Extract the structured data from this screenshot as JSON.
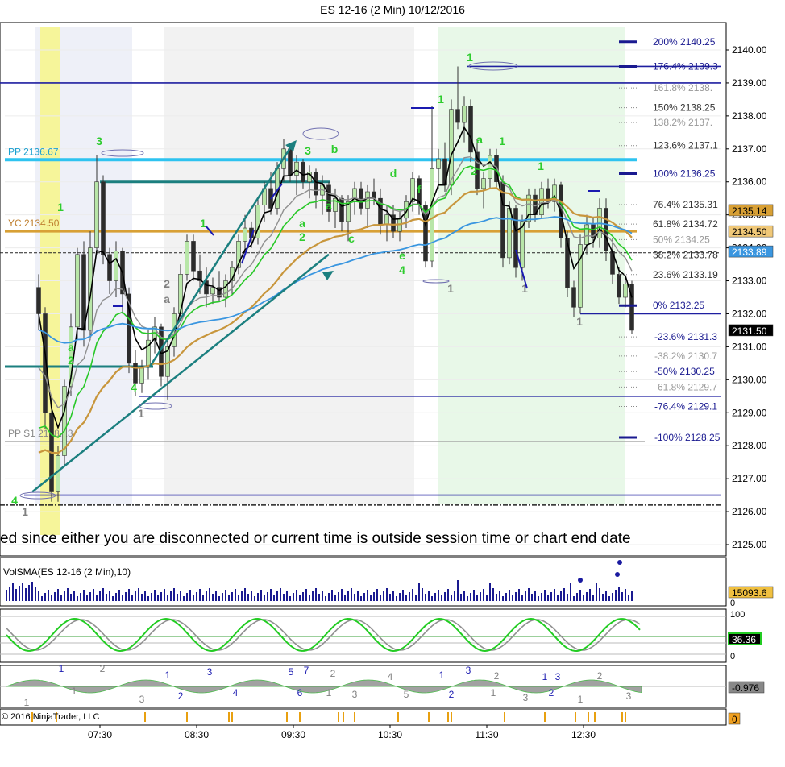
{
  "title": "ES 12-16 (2 Min)  10/12/2016",
  "copyright": "© 2016 NinjaTrader, LLC",
  "banner": "ed since either you are disconnected or current time is outside session time or chart end date",
  "colors": {
    "candle_up": "#b8e6a8",
    "candle_down": "#2c2c2c",
    "fib": "#1f1fa0",
    "pp": "#2ec3f0",
    "yc": "#d8a035",
    "ema_fast": "#000000",
    "ema_green": "#28c828",
    "ema_gold": "#c8963c",
    "ema_blue": "#3a96e0",
    "ema_gray": "#909090",
    "label_green": "#2ecc2e",
    "label_blue": "#1a1ab0",
    "label_gray": "#808080",
    "teal": "#1b7f7f"
  },
  "chart_data": [
    {
      "type": "candlestick",
      "name": "ES 12-16 (2 Min)",
      "ylim": [
        2124.8,
        2140.8
      ],
      "xlim": [
        "06:50",
        "13:50"
      ],
      "yticks": [
        "2125.00",
        "2126.00",
        "2127.00",
        "2128.00",
        "2129.00",
        "2130.00",
        "2131.00",
        "2132.00",
        "2133.00",
        "2134.00",
        "2135.00",
        "2136.00",
        "2137.00",
        "2138.00",
        "2139.00",
        "2140.00"
      ],
      "xticks": [
        "07:30",
        "08:30",
        "09:30",
        "10:30",
        "11:30",
        "12:30"
      ],
      "session_shading": [
        {
          "from": "06:50",
          "to": "07:50",
          "color": "#eef0f8"
        },
        {
          "from": "08:10",
          "to": "10:45",
          "color": "#f2f2f2"
        },
        {
          "from": "11:00",
          "to": "12:56",
          "color": "#e8f8e8"
        },
        {
          "from": "06:53",
          "to": "07:05",
          "color": "#f6f59a"
        }
      ],
      "candles": [
        {
          "t": "06:52",
          "o": 2132.8,
          "h": 2133.2,
          "l": 2131.5,
          "c": 2132.0
        },
        {
          "t": "06:56",
          "o": 2132.0,
          "h": 2132.2,
          "l": 2128.5,
          "c": 2129.0
        },
        {
          "t": "07:00",
          "o": 2129.0,
          "h": 2129.5,
          "l": 2126.3,
          "c": 2126.6
        },
        {
          "t": "07:04",
          "o": 2126.6,
          "h": 2128.0,
          "l": 2126.3,
          "c": 2127.7
        },
        {
          "t": "07:08",
          "o": 2127.7,
          "h": 2130.0,
          "l": 2127.4,
          "c": 2129.8
        },
        {
          "t": "07:12",
          "o": 2129.8,
          "h": 2132.0,
          "l": 2129.5,
          "c": 2131.6
        },
        {
          "t": "07:16",
          "o": 2131.6,
          "h": 2134.0,
          "l": 2131.2,
          "c": 2133.8
        },
        {
          "t": "07:20",
          "o": 2133.8,
          "h": 2134.2,
          "l": 2131.0,
          "c": 2131.5
        },
        {
          "t": "07:24",
          "o": 2131.5,
          "h": 2134.5,
          "l": 2131.2,
          "c": 2134.0
        },
        {
          "t": "07:28",
          "o": 2134.0,
          "h": 2136.8,
          "l": 2133.8,
          "c": 2136.0
        },
        {
          "t": "07:32",
          "o": 2136.0,
          "h": 2136.2,
          "l": 2133.5,
          "c": 2133.8
        },
        {
          "t": "07:36",
          "o": 2133.8,
          "h": 2134.0,
          "l": 2132.6,
          "c": 2133.0
        },
        {
          "t": "07:40",
          "o": 2133.0,
          "h": 2134.2,
          "l": 2132.5,
          "c": 2133.9
        },
        {
          "t": "07:44",
          "o": 2133.9,
          "h": 2134.0,
          "l": 2132.0,
          "c": 2132.6
        },
        {
          "t": "07:48",
          "o": 2132.6,
          "h": 2132.8,
          "l": 2130.2,
          "c": 2130.5
        },
        {
          "t": "07:52",
          "o": 2130.5,
          "h": 2130.9,
          "l": 2129.5,
          "c": 2129.9
        },
        {
          "t": "07:56",
          "o": 2129.9,
          "h": 2130.6,
          "l": 2129.6,
          "c": 2130.4
        },
        {
          "t": "08:00",
          "o": 2130.4,
          "h": 2131.5,
          "l": 2130.0,
          "c": 2131.2
        },
        {
          "t": "08:04",
          "o": 2131.2,
          "h": 2131.9,
          "l": 2130.8,
          "c": 2131.6
        },
        {
          "t": "08:08",
          "o": 2131.6,
          "h": 2131.7,
          "l": 2129.8,
          "c": 2130.1
        },
        {
          "t": "08:12",
          "o": 2130.1,
          "h": 2131.2,
          "l": 2129.4,
          "c": 2131.0
        },
        {
          "t": "08:16",
          "o": 2131.0,
          "h": 2132.2,
          "l": 2130.7,
          "c": 2132.0
        },
        {
          "t": "08:20",
          "o": 2132.0,
          "h": 2133.5,
          "l": 2131.8,
          "c": 2133.2
        },
        {
          "t": "08:24",
          "o": 2133.2,
          "h": 2134.4,
          "l": 2133.0,
          "c": 2134.2
        },
        {
          "t": "08:28",
          "o": 2134.2,
          "h": 2134.4,
          "l": 2133.0,
          "c": 2133.3
        },
        {
          "t": "08:32",
          "o": 2133.3,
          "h": 2133.8,
          "l": 2132.6,
          "c": 2133.0
        },
        {
          "t": "08:36",
          "o": 2133.0,
          "h": 2133.4,
          "l": 2132.2,
          "c": 2132.6
        },
        {
          "t": "08:40",
          "o": 2132.6,
          "h": 2133.1,
          "l": 2132.3,
          "c": 2132.8
        },
        {
          "t": "08:44",
          "o": 2132.8,
          "h": 2133.3,
          "l": 2132.4,
          "c": 2132.5
        },
        {
          "t": "08:48",
          "o": 2132.5,
          "h": 2133.2,
          "l": 2132.2,
          "c": 2133.0
        },
        {
          "t": "08:52",
          "o": 2133.0,
          "h": 2133.6,
          "l": 2132.6,
          "c": 2133.4
        },
        {
          "t": "08:56",
          "o": 2133.4,
          "h": 2134.4,
          "l": 2133.2,
          "c": 2134.2
        },
        {
          "t": "09:00",
          "o": 2134.2,
          "h": 2135.0,
          "l": 2133.8,
          "c": 2134.6
        },
        {
          "t": "09:04",
          "o": 2134.6,
          "h": 2134.8,
          "l": 2134.0,
          "c": 2134.3
        },
        {
          "t": "09:08",
          "o": 2134.3,
          "h": 2135.5,
          "l": 2134.1,
          "c": 2135.3
        },
        {
          "t": "09:12",
          "o": 2135.3,
          "h": 2136.0,
          "l": 2134.8,
          "c": 2135.8
        },
        {
          "t": "09:16",
          "o": 2135.8,
          "h": 2136.3,
          "l": 2135.0,
          "c": 2135.2
        },
        {
          "t": "09:20",
          "o": 2135.2,
          "h": 2136.6,
          "l": 2135.0,
          "c": 2136.4
        },
        {
          "t": "09:24",
          "o": 2136.4,
          "h": 2137.3,
          "l": 2136.0,
          "c": 2137.0
        },
        {
          "t": "09:28",
          "o": 2137.0,
          "h": 2137.1,
          "l": 2136.0,
          "c": 2136.2
        },
        {
          "t": "09:32",
          "o": 2136.2,
          "h": 2136.8,
          "l": 2135.6,
          "c": 2136.6
        },
        {
          "t": "09:36",
          "o": 2136.6,
          "h": 2136.7,
          "l": 2135.8,
          "c": 2136.0
        },
        {
          "t": "09:40",
          "o": 2136.0,
          "h": 2136.5,
          "l": 2135.5,
          "c": 2136.3
        },
        {
          "t": "09:44",
          "o": 2136.3,
          "h": 2136.4,
          "l": 2135.2,
          "c": 2135.6
        },
        {
          "t": "09:48",
          "o": 2135.6,
          "h": 2136.2,
          "l": 2135.0,
          "c": 2135.9
        },
        {
          "t": "09:52",
          "o": 2135.9,
          "h": 2136.0,
          "l": 2134.8,
          "c": 2135.1
        },
        {
          "t": "09:56",
          "o": 2135.1,
          "h": 2135.8,
          "l": 2134.6,
          "c": 2135.5
        },
        {
          "t": "10:00",
          "o": 2135.5,
          "h": 2135.6,
          "l": 2134.5,
          "c": 2134.8
        },
        {
          "t": "10:04",
          "o": 2134.8,
          "h": 2135.6,
          "l": 2134.2,
          "c": 2135.4
        },
        {
          "t": "10:08",
          "o": 2135.4,
          "h": 2136.0,
          "l": 2135.0,
          "c": 2135.8
        },
        {
          "t": "10:12",
          "o": 2135.8,
          "h": 2136.0,
          "l": 2135.0,
          "c": 2135.2
        },
        {
          "t": "10:16",
          "o": 2135.2,
          "h": 2135.9,
          "l": 2134.6,
          "c": 2135.7
        },
        {
          "t": "10:20",
          "o": 2135.7,
          "h": 2136.1,
          "l": 2135.3,
          "c": 2135.5
        },
        {
          "t": "10:24",
          "o": 2135.5,
          "h": 2135.8,
          "l": 2134.4,
          "c": 2134.7
        },
        {
          "t": "10:28",
          "o": 2134.7,
          "h": 2135.3,
          "l": 2134.2,
          "c": 2135.0
        },
        {
          "t": "10:32",
          "o": 2135.0,
          "h": 2135.3,
          "l": 2134.3,
          "c": 2134.5
        },
        {
          "t": "10:36",
          "o": 2134.5,
          "h": 2135.1,
          "l": 2134.2,
          "c": 2134.9
        },
        {
          "t": "10:40",
          "o": 2134.9,
          "h": 2135.6,
          "l": 2134.6,
          "c": 2135.4
        },
        {
          "t": "10:44",
          "o": 2135.4,
          "h": 2136.3,
          "l": 2135.1,
          "c": 2136.1
        },
        {
          "t": "10:48",
          "o": 2136.1,
          "h": 2136.2,
          "l": 2135.0,
          "c": 2135.3
        },
        {
          "t": "10:52",
          "o": 2135.3,
          "h": 2135.4,
          "l": 2133.4,
          "c": 2133.6
        },
        {
          "t": "10:56",
          "o": 2133.6,
          "h": 2138.3,
          "l": 2133.4,
          "c": 2136.4
        },
        {
          "t": "11:00",
          "o": 2136.4,
          "h": 2137.0,
          "l": 2135.8,
          "c": 2136.7
        },
        {
          "t": "11:04",
          "o": 2136.7,
          "h": 2137.2,
          "l": 2135.7,
          "c": 2135.9
        },
        {
          "t": "11:08",
          "o": 2135.9,
          "h": 2138.5,
          "l": 2135.6,
          "c": 2138.2
        },
        {
          "t": "11:12",
          "o": 2138.2,
          "h": 2139.5,
          "l": 2137.6,
          "c": 2137.8
        },
        {
          "t": "11:16",
          "o": 2137.8,
          "h": 2138.6,
          "l": 2137.2,
          "c": 2138.3
        },
        {
          "t": "11:20",
          "o": 2138.3,
          "h": 2138.5,
          "l": 2136.6,
          "c": 2136.9
        },
        {
          "t": "11:24",
          "o": 2136.9,
          "h": 2137.3,
          "l": 2135.6,
          "c": 2135.8
        },
        {
          "t": "11:28",
          "o": 2135.8,
          "h": 2136.3,
          "l": 2135.2,
          "c": 2136.1
        },
        {
          "t": "11:32",
          "o": 2136.1,
          "h": 2137.0,
          "l": 2135.8,
          "c": 2136.8
        },
        {
          "t": "11:36",
          "o": 2136.8,
          "h": 2137.0,
          "l": 2135.8,
          "c": 2136.0
        },
        {
          "t": "11:40",
          "o": 2136.0,
          "h": 2136.2,
          "l": 2133.4,
          "c": 2133.7
        },
        {
          "t": "11:44",
          "o": 2133.7,
          "h": 2135.4,
          "l": 2133.5,
          "c": 2135.2
        },
        {
          "t": "11:48",
          "o": 2135.2,
          "h": 2135.3,
          "l": 2133.1,
          "c": 2133.4
        },
        {
          "t": "11:52",
          "o": 2133.4,
          "h": 2135.0,
          "l": 2133.0,
          "c": 2134.8
        },
        {
          "t": "11:56",
          "o": 2134.8,
          "h": 2135.8,
          "l": 2134.6,
          "c": 2135.6
        },
        {
          "t": "12:00",
          "o": 2135.6,
          "h": 2135.8,
          "l": 2134.8,
          "c": 2135.0
        },
        {
          "t": "12:04",
          "o": 2135.0,
          "h": 2136.0,
          "l": 2134.9,
          "c": 2135.8
        },
        {
          "t": "12:08",
          "o": 2135.8,
          "h": 2136.1,
          "l": 2135.2,
          "c": 2135.4
        },
        {
          "t": "12:12",
          "o": 2135.4,
          "h": 2136.1,
          "l": 2135.1,
          "c": 2135.9
        },
        {
          "t": "12:16",
          "o": 2135.9,
          "h": 2136.0,
          "l": 2134.0,
          "c": 2134.3
        },
        {
          "t": "12:20",
          "o": 2134.3,
          "h": 2134.5,
          "l": 2132.5,
          "c": 2132.8
        },
        {
          "t": "12:24",
          "o": 2132.8,
          "h": 2133.0,
          "l": 2131.9,
          "c": 2132.2
        },
        {
          "t": "12:28",
          "o": 2132.2,
          "h": 2134.4,
          "l": 2132.0,
          "c": 2134.1
        },
        {
          "t": "12:32",
          "o": 2134.1,
          "h": 2135.0,
          "l": 2133.8,
          "c": 2134.7
        },
        {
          "t": "12:36",
          "o": 2134.7,
          "h": 2134.9,
          "l": 2134.0,
          "c": 2134.3
        },
        {
          "t": "12:40",
          "o": 2134.3,
          "h": 2135.5,
          "l": 2134.0,
          "c": 2135.2
        },
        {
          "t": "12:44",
          "o": 2135.2,
          "h": 2135.5,
          "l": 2133.6,
          "c": 2133.9
        },
        {
          "t": "12:48",
          "o": 2133.9,
          "h": 2134.3,
          "l": 2132.9,
          "c": 2133.2
        },
        {
          "t": "12:52",
          "o": 2133.2,
          "h": 2133.4,
          "l": 2132.3,
          "c": 2132.5
        },
        {
          "t": "12:56",
          "o": 2132.5,
          "h": 2133.1,
          "l": 2132.2,
          "c": 2132.9
        },
        {
          "t": "13:00",
          "o": 2132.9,
          "h": 2133.0,
          "l": 2131.4,
          "c": 2131.5
        }
      ],
      "horizontal_levels": [
        {
          "label": "PP 2136.67",
          "value": 2136.67,
          "kind": "pp"
        },
        {
          "label": "YC 2134.50",
          "value": 2134.5,
          "kind": "yc"
        },
        {
          "label": "PP S1 2128.13",
          "value": 2128.13,
          "kind": "gray"
        }
      ],
      "fib_levels": [
        {
          "pct": "200%",
          "value": "2140.25",
          "y": 2140.25,
          "style": "solid"
        },
        {
          "pct": "176.4%",
          "value": "2139.3",
          "y": 2139.5,
          "style": "solid"
        },
        {
          "pct": "161.8%",
          "value": "2138.",
          "y": 2138.85,
          "style": "dotted"
        },
        {
          "pct": "150%",
          "value": "2138.25",
          "y": 2138.25,
          "style": "dotted"
        },
        {
          "pct": "138.2%",
          "value": "2137.",
          "y": 2137.8,
          "style": "dotted"
        },
        {
          "pct": "123.6%",
          "value": "2137.1",
          "y": 2137.1,
          "style": "dotted"
        },
        {
          "pct": "100%",
          "value": "2136.25",
          "y": 2136.25,
          "style": "solid"
        },
        {
          "pct": "76.4%",
          "value": "2135.31",
          "y": 2135.31,
          "style": "dotted"
        },
        {
          "pct": "61.8%",
          "value": "2134.72",
          "y": 2134.72,
          "style": "dotted"
        },
        {
          "pct": "50%",
          "value": "2134.25",
          "y": 2134.25,
          "style": "dotted"
        },
        {
          "pct": "38.2%",
          "value": "2133.78",
          "y": 2133.78,
          "style": "dotted"
        },
        {
          "pct": "23.6%",
          "value": "2133.19",
          "y": 2133.19,
          "style": "dotted"
        },
        {
          "pct": "0%",
          "value": "2132.25",
          "y": 2132.25,
          "style": "solid"
        },
        {
          "pct": "-23.6%",
          "value": "2131.3",
          "y": 2131.3,
          "style": "dotted"
        },
        {
          "pct": "-38.2%",
          "value": "2130.7",
          "y": 2130.72,
          "style": "dotted"
        },
        {
          "pct": "-50%",
          "value": "2130.25",
          "y": 2130.25,
          "style": "dotted"
        },
        {
          "pct": "-61.8%",
          "value": "2129.7",
          "y": 2129.78,
          "style": "dotted"
        },
        {
          "pct": "-76.4%",
          "value": "2129.1",
          "y": 2129.19,
          "style": "dotted"
        },
        {
          "pct": "-100%",
          "value": "2128.25",
          "y": 2128.25,
          "style": "solid"
        }
      ],
      "price_tags": [
        {
          "value": "2135.14",
          "y": 2135.14,
          "bg": "#d8a035",
          "fg": "#000000"
        },
        {
          "value": "2134.50",
          "y": 2134.5,
          "bg": "#f0c878",
          "fg": "#000000"
        },
        {
          "value": "2133.89",
          "y": 2133.89,
          "bg": "#3a96e0",
          "fg": "#ffffff"
        },
        {
          "value": "2131.50",
          "y": 2131.5,
          "bg": "#000000",
          "fg": "#ffffff"
        }
      ]
    },
    {
      "type": "bar",
      "name": "VolSMA(ES 12-16 (2 Min),10)",
      "value_label": "15093.6",
      "zero_label": "0"
    },
    {
      "type": "line",
      "name": "stochastic",
      "ylim": [
        0,
        100
      ],
      "yticks": [
        "100",
        "0"
      ],
      "value_label": "36.36"
    },
    {
      "type": "area",
      "name": "wave-oscillator",
      "value_label": "-0.976"
    },
    {
      "type": "bar",
      "name": "markers",
      "value_label": "0"
    }
  ]
}
